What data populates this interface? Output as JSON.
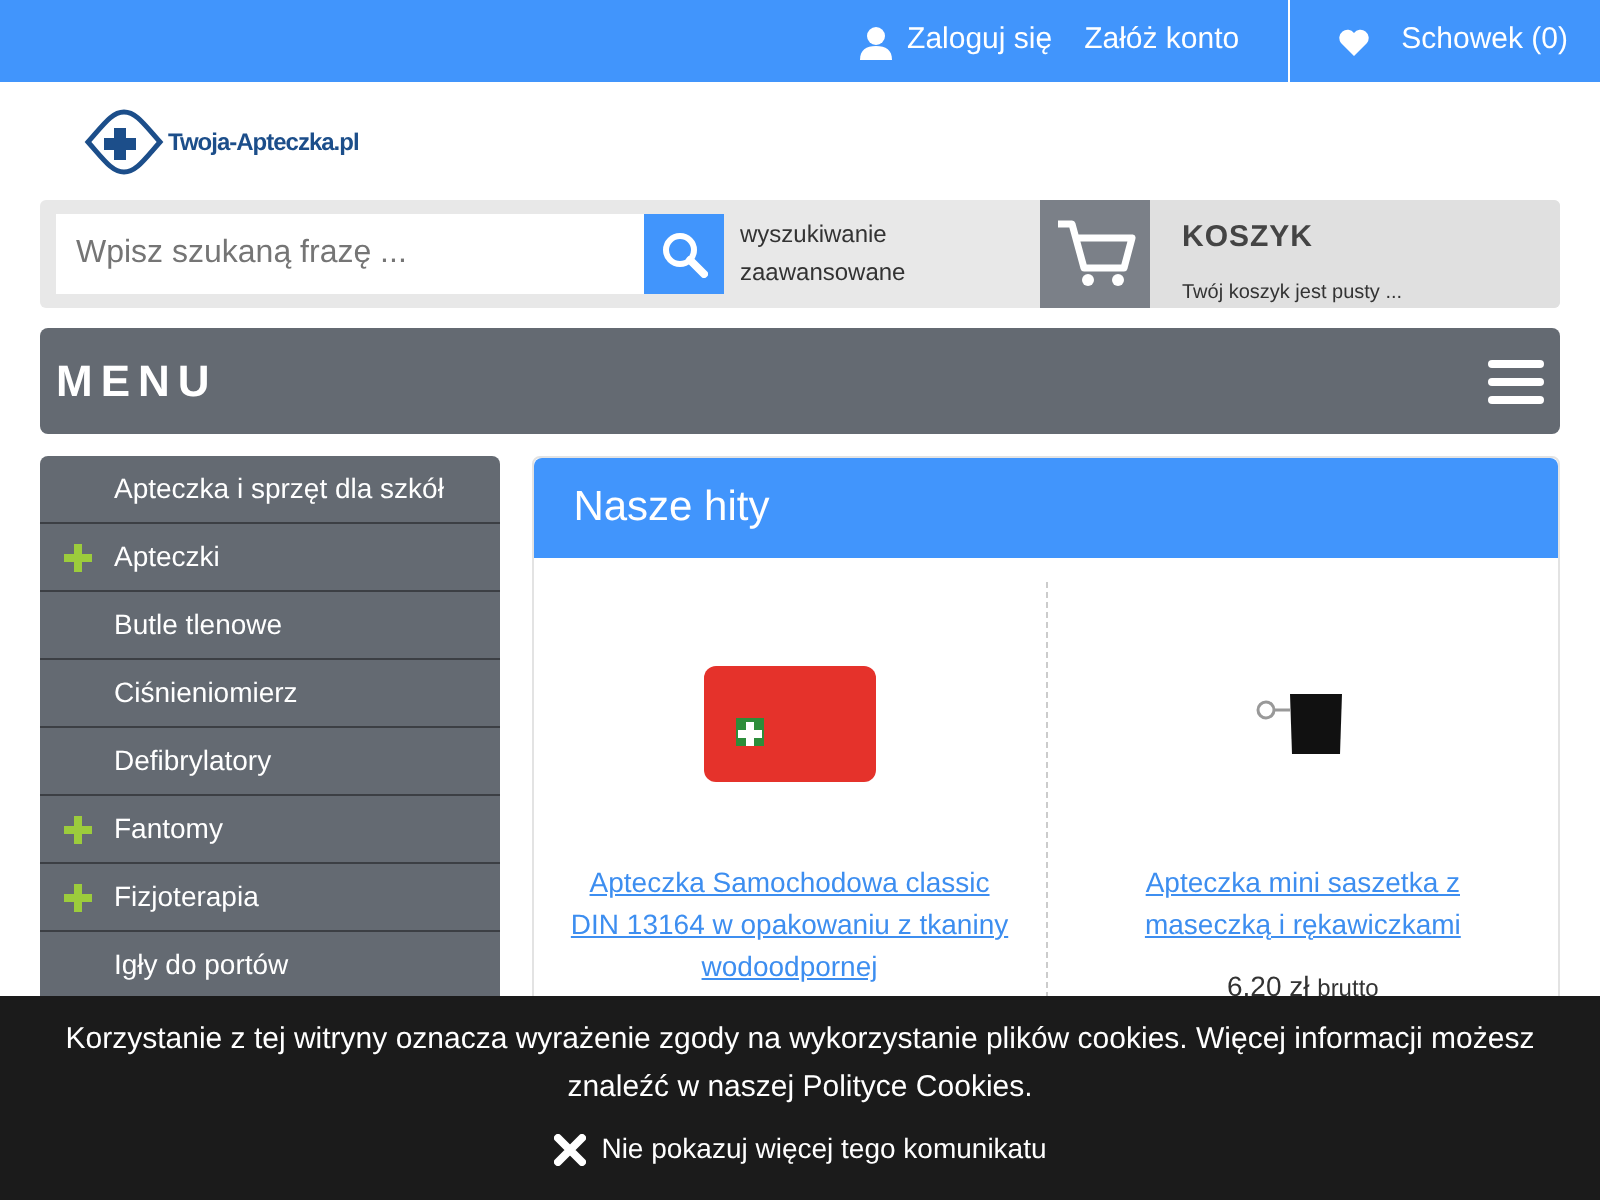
{
  "top_bar": {
    "login": "Zaloguj się",
    "register": "Załóż konto",
    "wishlist": "Schowek (0)"
  },
  "logo": {
    "text": "Twoja-Apteczka.pl"
  },
  "search": {
    "placeholder": "Wpisz szukaną frazę ...",
    "advanced_line_1": "wyszukiwanie",
    "advanced_line_2": "zaawansowane"
  },
  "cart": {
    "title": "KOSZYK",
    "status": "Twój koszyk jest pusty ..."
  },
  "menu": {
    "title": "MENU"
  },
  "sidebar": {
    "items": [
      {
        "label": "Apteczka i sprzęt dla szkół",
        "expandable": false
      },
      {
        "label": "Apteczki",
        "expandable": true
      },
      {
        "label": "Butle tlenowe",
        "expandable": false
      },
      {
        "label": "Ciśnieniomierz",
        "expandable": false
      },
      {
        "label": "Defibrylatory",
        "expandable": false
      },
      {
        "label": "Fantomy",
        "expandable": true
      },
      {
        "label": "Fizjoterapia",
        "expandable": true
      },
      {
        "label": "Igły do portów",
        "expandable": false
      }
    ]
  },
  "section": {
    "title": "Nasze hity",
    "products": [
      {
        "kind": "kit",
        "name": "Apteczka Samochodowa classic DIN 13164 w opakowaniu z tkaniny wodoodpornej"
      },
      {
        "kind": "pouch",
        "name": "Apteczka mini saszetka z maseczką i rękawiczkami",
        "price": "6,20 zł",
        "price_suffix": "brutto"
      }
    ]
  },
  "cookie_notice": {
    "text": "Korzystanie z tej witryny oznacza wyrażenie zgody na wykorzystanie plików cookies. Więcej informacji możesz znaleźć w naszej Polityce Cookies.",
    "dismiss": "Nie pokazuj więcej tego komunikatu"
  }
}
